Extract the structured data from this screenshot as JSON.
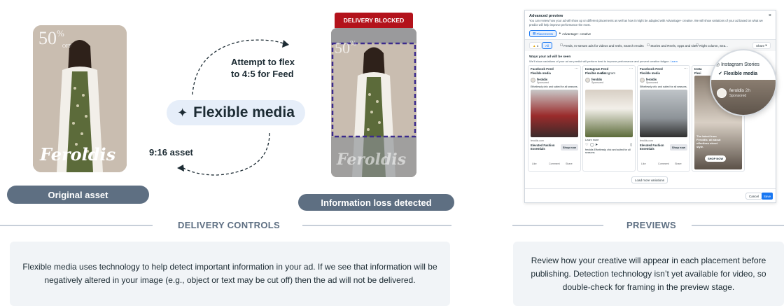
{
  "left": {
    "sale_number": "50",
    "sale_pct": "%",
    "sale_off": "OFF",
    "brand": "Feroldis",
    "original_label": "Original asset",
    "flexible_media": "Flexible media",
    "sparkle": "✦",
    "attempt_line1": "Attempt to flex",
    "attempt_line2": "to 4:5 for Feed",
    "asset_916": "9:16 asset",
    "delivery_blocked": "DELIVERY BLOCKED",
    "info_loss": "Information loss detected"
  },
  "sections": {
    "delivery_controls": "DELIVERY CONTROLS",
    "delivery_text": "Flexible media uses technology to help detect important information in your ad. If we see that information will be negatively altered in your image (e.g., object or text may be cut off) then the ad will not be delivered.",
    "previews": "PREVIEWS",
    "previews_text": "Review how your creative will appear in each placement before publishing. Detection technology isn’t yet available for video, so double-check for framing in the preview stage."
  },
  "dialog": {
    "title": "Advanced preview",
    "desc": "You can review how your ad will show up on different placements as well as how it might be adapted with Advantage+ creative. We will show variations of your ad based on what we predict will help improve performance the most.",
    "tab_placements": "Placements",
    "tab_advantage": "Advantage+ creative",
    "count_warn": "1",
    "filter_all": "All",
    "filter_feeds": "Feeds, In-stream ads for videos and reels, Search results",
    "filter_stories": "Stories and Reels, Apps and sites",
    "filter_right": "Right column, Sea...",
    "share": "Share",
    "ways_heading": "Ways your ad will be seen",
    "ways_desc": "We'll show variations of your ad we predict will perform best to improve performance and prevent creative fatigue.",
    "learn": "Learn",
    "columns": [
      {
        "placement": "Facebook Feed",
        "tag": "Flexible media",
        "page": "feroldis",
        "sponsored": "Sponsored",
        "body": "Effortlessly chic and suited for all seasons.",
        "url": "feroldis.com",
        "headline": "Elevated Fashion Essentials",
        "cta": "Shop now",
        "actions": [
          "Like",
          "Comment",
          "Share"
        ]
      },
      {
        "placement": "Instagram Feed",
        "tag": "Flexible media",
        "page": "feroldis",
        "sponsored": "Sponsored",
        "top": "Instagram",
        "learn": "Learn more",
        "body": "feroldis Effortlessly chic and suited for all seasons."
      },
      {
        "placement": "Facebook Feed",
        "tag": "Flexible media",
        "page": "feroldis",
        "sponsored": "Sponsored",
        "body": "Effortlessly chic and suited for all seasons.",
        "url": "feroldis.com",
        "headline": "Elevated Fashion Essentials",
        "cta": "Shop now",
        "actions": [
          "Like",
          "Comment",
          "Share"
        ]
      },
      {
        "placement": "Insta",
        "tag": "Flexi",
        "page": "feroldis",
        "sponsored": "Sponsored",
        "overlay": "The latest from Feroldis: all about effortless street style.",
        "cta": "SHOP NOW"
      }
    ],
    "load_more": "Load more variations",
    "cancel": "Cancel",
    "save": "Save"
  },
  "magnifier": {
    "title": "Instagram Stories",
    "tag": "Flexible media",
    "page": "feroldis",
    "time": "2h",
    "sponsored": "Sponsored"
  },
  "colors": {
    "accent_blue": "#1877f2",
    "blocked_red": "#b3121b",
    "pill_slate": "#5e6f82",
    "dashed_purple": "#3b2a8c"
  }
}
